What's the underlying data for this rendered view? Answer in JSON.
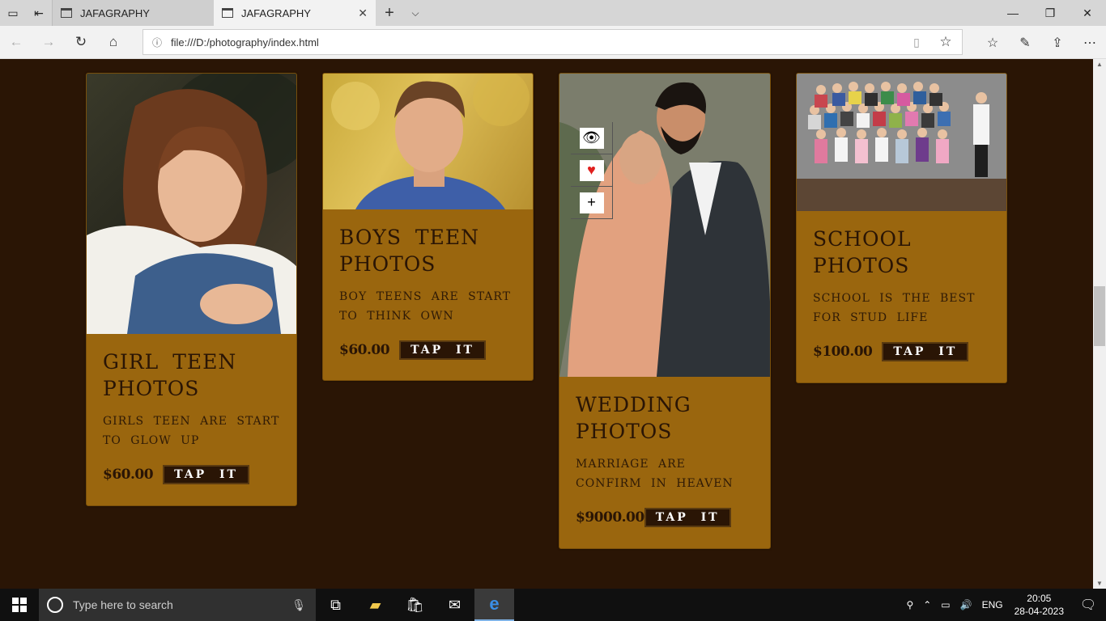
{
  "browser": {
    "tabs": [
      {
        "title": "JAFAGRAPHY",
        "active": false
      },
      {
        "title": "JAFAGRAPHY",
        "active": true
      }
    ],
    "url": "file:///D:/photography/index.html"
  },
  "cards": [
    {
      "title_line1": "GIRL TEEN",
      "title_line2": "PHOTOS",
      "description": "GIRLS TEEN ARE START TO GLOW UP",
      "price": "$60.00",
      "button": "TAP IT"
    },
    {
      "title_line1": "BOYS TEEN",
      "title_line2": "PHOTOS",
      "description": "BOY TEENS ARE START TO THINK OWN",
      "price": "$60.00",
      "button": "TAP IT"
    },
    {
      "title_line1": "WEDDING",
      "title_line2": "PHOTOS",
      "description": "MARRIAGE ARE CONFIRM IN HEAVEN",
      "price": "$9000.00",
      "button": "TAP IT"
    },
    {
      "title_line1": "SCHOOL",
      "title_line2": "PHOTOS",
      "description": "SCHOOL IS THE BEST FOR STUD LIFE",
      "price": "$100.00",
      "button": "TAP IT"
    }
  ],
  "overlay_icons": [
    "eye-icon",
    "heart-icon",
    "plus-icon"
  ],
  "colors": {
    "page_bg": "#2a1505",
    "card_bg": "#9a660e",
    "button_bg": "#2a1505"
  },
  "taskbar": {
    "search_placeholder": "Type here to search",
    "language": "ENG",
    "time": "20:05",
    "date": "28-04-2023"
  }
}
